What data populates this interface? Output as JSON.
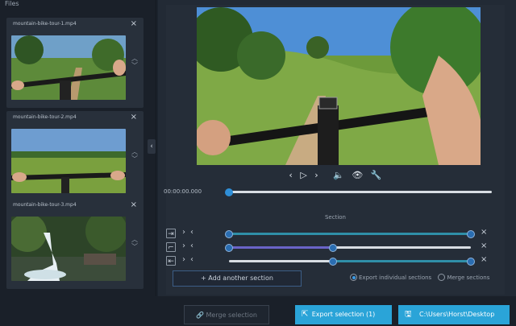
{
  "files_panel": {
    "title": "Files",
    "items": [
      {
        "name": "mountain-bike-tour-1.mp4"
      },
      {
        "name": "mountain-bike-tour-2.mp4"
      },
      {
        "name": "mountain-bike-tour-3.mp4"
      }
    ]
  },
  "player": {
    "timecode": "00:00:00.000",
    "position_fraction": 0
  },
  "sections": {
    "label": "Section",
    "rows": [
      {
        "start": 0.0,
        "end": 1.0,
        "track_color": "#2f8fa8"
      },
      {
        "start": 0.0,
        "end": 0.43,
        "track_color": "#6a64c8"
      },
      {
        "start": 0.43,
        "end": 1.0,
        "track_color": "#2f8fa8"
      }
    ],
    "add_label": "+ Add another section",
    "export_options": [
      {
        "label": "Export individual sections",
        "selected": true
      },
      {
        "label": "Merge sections",
        "selected": false
      }
    ]
  },
  "bottom_bar": {
    "merge_label": "Merge selection",
    "export_label": "Export selection (1)",
    "path_label": "C:\\Users\\Horst\\Desktop"
  },
  "colors": {
    "accent": "#2aa4d8",
    "timeline_thumb": "#2f8fd8"
  }
}
